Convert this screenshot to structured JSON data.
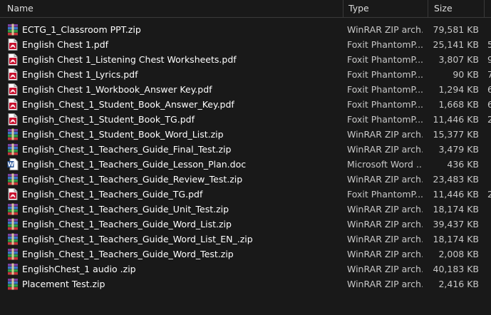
{
  "columns": {
    "name": "Name",
    "type": "Type",
    "size": "Size"
  },
  "files": [
    {
      "name": "ECTG_1_Classroom PPT.zip",
      "type": "WinRAR ZIP arch...",
      "size": "79,581 KB",
      "icon": "winrar-archive-icon",
      "extra": ""
    },
    {
      "name": "English Chest 1.pdf",
      "type": "Foxit PhantomP...",
      "size": "25,141 KB",
      "icon": "pdf-document-icon",
      "extra": "5"
    },
    {
      "name": "English Chest 1_Listening Chest Worksheets.pdf",
      "type": "Foxit PhantomP...",
      "size": "3,807 KB",
      "icon": "pdf-document-icon",
      "extra": "9"
    },
    {
      "name": "English Chest 1_Lyrics.pdf",
      "type": "Foxit PhantomP...",
      "size": "90 KB",
      "icon": "pdf-document-icon",
      "extra": "7"
    },
    {
      "name": "English Chest 1_Workbook_Answer Key.pdf",
      "type": "Foxit PhantomP...",
      "size": "1,294 KB",
      "icon": "pdf-document-icon",
      "extra": "6"
    },
    {
      "name": "English_Chest_1_Student_Book_Answer_Key.pdf",
      "type": "Foxit PhantomP...",
      "size": "1,668 KB",
      "icon": "pdf-document-icon",
      "extra": "6"
    },
    {
      "name": "English_Chest_1_Student_Book_TG.pdf",
      "type": "Foxit PhantomP...",
      "size": "11,446 KB",
      "icon": "pdf-document-icon",
      "extra": "2"
    },
    {
      "name": "English_Chest_1_Student_Book_Word_List.zip",
      "type": "WinRAR ZIP arch...",
      "size": "15,377 KB",
      "icon": "winrar-archive-icon",
      "extra": ""
    },
    {
      "name": "English_Chest_1_Teachers_Guide_Final_Test.zip",
      "type": "WinRAR ZIP arch...",
      "size": "3,479 KB",
      "icon": "winrar-archive-icon",
      "extra": ""
    },
    {
      "name": "English_Chest_1_Teachers_Guide_Lesson_Plan.doc",
      "type": "Microsoft Word ...",
      "size": "436 KB",
      "icon": "word-document-icon",
      "extra": ""
    },
    {
      "name": "English_Chest_1_Teachers_Guide_Review_Test.zip",
      "type": "WinRAR ZIP arch...",
      "size": "23,483 KB",
      "icon": "winrar-archive-icon",
      "extra": ""
    },
    {
      "name": "English_Chest_1_Teachers_Guide_TG.pdf",
      "type": "Foxit PhantomP...",
      "size": "11,446 KB",
      "icon": "pdf-document-icon",
      "extra": "2"
    },
    {
      "name": "English_Chest_1_Teachers_Guide_Unit_Test.zip",
      "type": "WinRAR ZIP arch...",
      "size": "18,174 KB",
      "icon": "winrar-archive-icon",
      "extra": ""
    },
    {
      "name": "English_Chest_1_Teachers_Guide_Word_List.zip",
      "type": "WinRAR ZIP arch...",
      "size": "39,437 KB",
      "icon": "winrar-archive-icon",
      "extra": ""
    },
    {
      "name": "English_Chest_1_Teachers_Guide_Word_List_EN_.zip",
      "type": "WinRAR ZIP arch...",
      "size": "18,174 KB",
      "icon": "winrar-archive-icon",
      "extra": ""
    },
    {
      "name": "English_Chest_1_Teachers_Guide_Word_Test.zip",
      "type": "WinRAR ZIP arch...",
      "size": "2,008 KB",
      "icon": "winrar-archive-icon",
      "extra": ""
    },
    {
      "name": "EnglishChest_1 audio .zip",
      "type": "WinRAR ZIP arch...",
      "size": "40,183 KB",
      "icon": "winrar-archive-icon",
      "extra": ""
    },
    {
      "name": "Placement Test.zip",
      "type": "WinRAR ZIP arch...",
      "size": "2,416 KB",
      "icon": "winrar-archive-icon",
      "extra": ""
    }
  ],
  "colors": {
    "background": "#191919",
    "pdf_icon": "#c8102e",
    "word_icon": "#2b579a",
    "winrar_stack": [
      "#7a3fa0",
      "#3a78c8",
      "#2f9b45",
      "#c8323a"
    ]
  }
}
